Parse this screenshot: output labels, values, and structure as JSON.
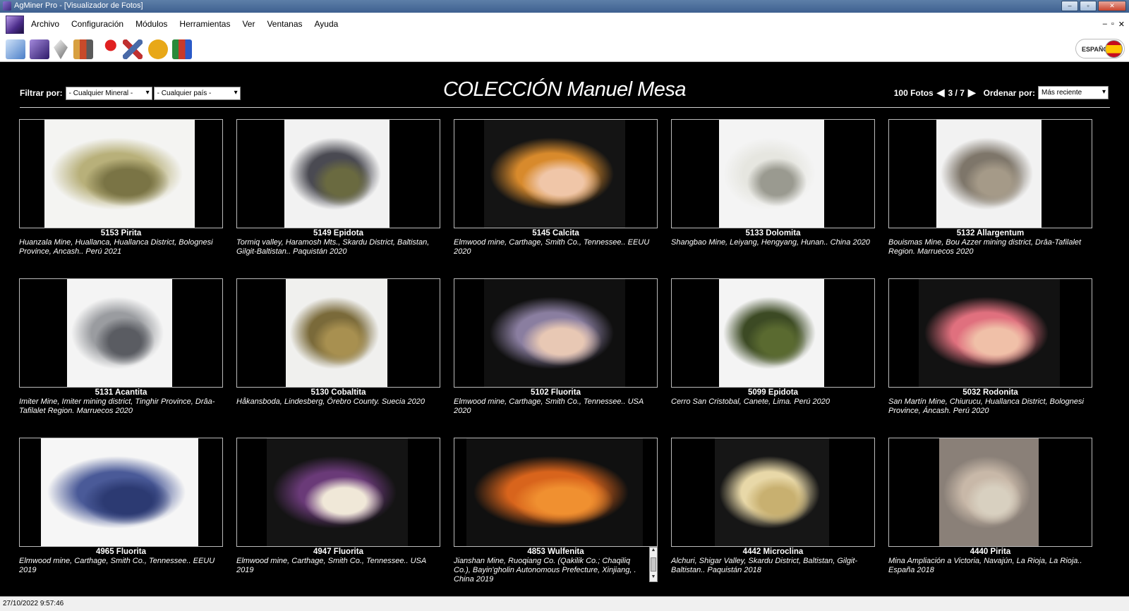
{
  "window": {
    "title": "AgMiner Pro - [Visualizador de Fotos]"
  },
  "menu": {
    "items": [
      {
        "label": "Archivo"
      },
      {
        "label": "Configuración"
      },
      {
        "label": "Módulos"
      },
      {
        "label": "Herramientas"
      },
      {
        "label": "Ver"
      },
      {
        "label": "Ventanas"
      },
      {
        "label": "Ayuda"
      }
    ],
    "mdi_controls": [
      "–",
      "▫",
      "✕"
    ]
  },
  "toolbar": {
    "icons": [
      "minerals-icon",
      "collection-icon",
      "crystal-icon",
      "chart-icon",
      "locality-pin-icon",
      "tools-icon",
      "miner-icon",
      "books-icon"
    ],
    "language_label": "ESPAÑOL"
  },
  "header": {
    "filter_label": "Filtrar por:",
    "mineral_filter": "- Cualquier Mineral -",
    "country_filter": "- Cualquier país -",
    "title": "COLECCIÓN Manuel Mesa",
    "photo_count": "100 Fotos",
    "page": "3 / 7",
    "sort_label": "Ordenar por:",
    "sort_value": "Más reciente"
  },
  "photos": [
    {
      "title": "5153  Pirita",
      "location": "Huanzala Mine, Huallanca, Huallanca District, Bolognesi Province, Ancash.. Perú  2021",
      "colors": [
        "#f4f4f2",
        "#b8b07a",
        "#7a7445"
      ]
    },
    {
      "title": "5149  Epidota",
      "location": "Tormiq valley, Haramosh Mts., Skardu District, Baltistan, Gilgit-Baltistan.. Paquistán  2020",
      "colors": [
        "#f2f2f2",
        "#4a4a52",
        "#6a6a40"
      ]
    },
    {
      "title": "5145  Calcita",
      "location": "Elmwood mine,  Carthage, Smith Co., Tennessee.. EEUU  2020",
      "colors": [
        "#141414",
        "#d88a2c",
        "#f0c6a8"
      ]
    },
    {
      "title": "5133  Dolomita",
      "location": "Shangbao Mine, Leiyang, Hengyang, Hunan.. China  2020",
      "colors": [
        "#f4f4f4",
        "#e6e6e0",
        "#9a9a90"
      ]
    },
    {
      "title": "5132  Allargentum",
      "location": "Bouismas Mine, Bou Azzer mining district, Drâa-Tafilalet Region. Marruecos  2020",
      "colors": [
        "#f2f2f2",
        "#7e766a",
        "#a59a88"
      ]
    },
    {
      "title": "5131  Acantita",
      "location": "Imiter Mine, Imiter mining district, Tinghir Province, Drâa-Tafilalet Region. Marruecos  2020",
      "colors": [
        "#f4f4f4",
        "#9a9ca0",
        "#5a5c62"
      ]
    },
    {
      "title": "5130  Cobaltita",
      "location": "Håkansboda, Lindesberg, Örebro County. Suecia  2020",
      "colors": [
        "#f0f0ee",
        "#7a6a3a",
        "#a89050"
      ]
    },
    {
      "title": "5102  Fluorita",
      "location": "Elmwood mine,  Carthage, Smith Co., Tennessee.. USA  2020",
      "colors": [
        "#101010",
        "#8a7ea0",
        "#e8c8b4"
      ]
    },
    {
      "title": "5099  Epidota",
      "location": "Cerro San Cristobal, Canete, Lima. Perú  2020",
      "colors": [
        "#f4f4f4",
        "#3c4a24",
        "#5a6a30"
      ]
    },
    {
      "title": "5032  Rodonita",
      "location": "San Martín Mine, Chiurucu, Huallanca District, Bolognesi Province, Áncash. Perú  2020",
      "colors": [
        "#121212",
        "#e0707e",
        "#f0c0a8"
      ]
    },
    {
      "title": "4965  Fluorita",
      "location": "Elmwood mine,  Carthage, Smith Co., Tennessee.. EEUU  2019",
      "colors": [
        "#f6f6f6",
        "#4a5a98",
        "#2c3a72"
      ]
    },
    {
      "title": "4947  Fluorita",
      "location": "Elmwood mine,  Carthage, Smith Co., Tennessee.. USA  2019",
      "colors": [
        "#141414",
        "#6a3a78",
        "#f0e8d8"
      ]
    },
    {
      "title": "4853  Wulfenita",
      "location": "Jianshan Mine, Ruoqiang Co. (Qakilik Co.; Chaqiliq Co.), Bayin'gholin Autonomous Prefecture, Xinjiang, . China  2019",
      "colors": [
        "#101010",
        "#d8641c",
        "#f09030"
      ]
    },
    {
      "title": "4442  Microclina",
      "location": "Alchuri, Shigar Valley, Skardu District,  Baltistan, Gilgit-Baltistan.. Paquistán  2018",
      "colors": [
        "#161616",
        "#e8d8a8",
        "#c8b070"
      ]
    },
    {
      "title": "4440  Pirita",
      "location": "Mina Ampliación a Victoria, Navajún, La Rioja, La Rioja.. España  2018",
      "colors": [
        "#8a8078",
        "#c8b8a8",
        "#d8d0c0"
      ]
    }
  ],
  "status": {
    "datetime": "27/10/2022 9:57:46"
  }
}
